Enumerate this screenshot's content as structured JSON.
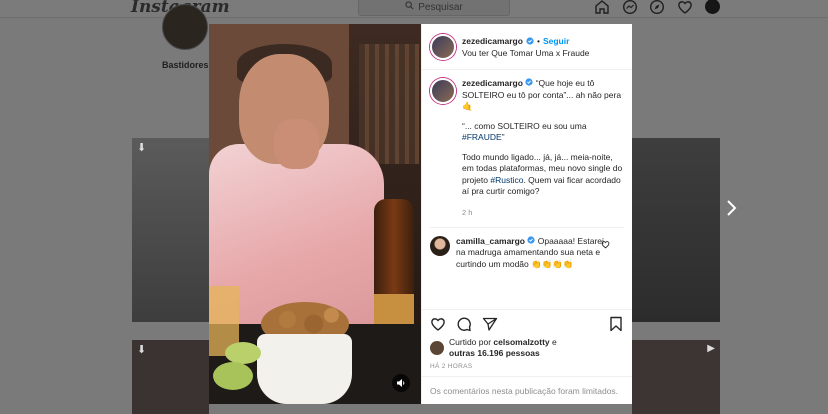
{
  "app": {
    "logo": "Instagram"
  },
  "search": {
    "placeholder": "Pesquisar"
  },
  "profile": {
    "highlight_label": "Bastidores"
  },
  "post": {
    "author": "zezedicamargo",
    "follow_label": "Seguir",
    "dot": "•",
    "song": "Vou ter Que Tomar Uma x Fraude",
    "caption": {
      "line1": "“Que hoje eu tô SOLTEIRO eu tô por conta”... ah não pera 🤙",
      "line2_prefix": "“... como SOLTEIRO eu sou uma ",
      "line2_tag": "#FRAUDE",
      "line2_suffix": "”",
      "line3_prefix": "Todo mundo ligado... já, já... meia-noite, em todas plataformas, meu novo single do projeto ",
      "line3_tag": "#Rustico",
      "line3_suffix": ". Quem vai ficar acordado aí pra curtir comigo?"
    },
    "caption_time": "2 h",
    "comment": {
      "author": "camilla_camargo",
      "text": "Opaaaaa! Estarei na madruga amamentando sua neta e curtindo um modão 👏👏👏👏"
    },
    "likes": {
      "prefix": "Curtido por ",
      "user": "celsomalzotty",
      "middle": " e",
      "others": "outras 16.196 pessoas"
    },
    "post_time": "HÁ 2 HORAS",
    "comments_limited": "Os comentários nesta publicação foram limitados."
  },
  "colors": {
    "accent": "#0095f6",
    "text": "#262626",
    "muted": "#8e8e8e",
    "overlay": "#7a7a7a"
  },
  "icons": [
    "search-icon",
    "home-icon",
    "messenger-icon",
    "explore-icon",
    "heart-icon",
    "verified-icon",
    "like-icon",
    "comment-icon",
    "share-icon",
    "save-icon",
    "sound-icon",
    "next-arrow-icon"
  ]
}
